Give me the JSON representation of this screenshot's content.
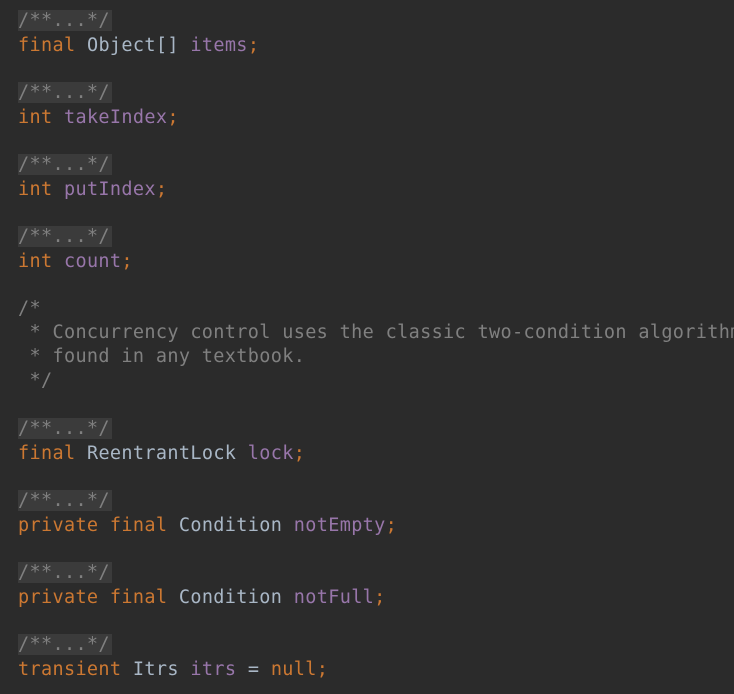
{
  "fold_placeholder": "/**...*/",
  "declarations": [
    {
      "modifiers": "final",
      "type": "Object[]",
      "name": "items",
      "end": ";"
    },
    {
      "modifiers": "int",
      "type": "",
      "name": "takeIndex",
      "end": ";"
    },
    {
      "modifiers": "int",
      "type": "",
      "name": "putIndex",
      "end": ";"
    },
    {
      "modifiers": "int",
      "type": "",
      "name": "count",
      "end": ";"
    },
    {
      "modifiers": "final",
      "type": "ReentrantLock",
      "name": "lock",
      "end": ";"
    },
    {
      "modifiers": "private final",
      "type": "Condition",
      "name": "notEmpty",
      "end": ";"
    },
    {
      "modifiers": "private final",
      "type": "Condition",
      "name": "notFull",
      "end": ";"
    },
    {
      "modifiers": "transient",
      "type": "Itrs",
      "name": "itrs",
      "assign": "=",
      "value": "null",
      "end": ";"
    }
  ],
  "block_comment": [
    "/*",
    " * Concurrency control uses the classic two-condition algorithm",
    " * found in any textbook.",
    " */"
  ],
  "colors": {
    "background": "#2b2b2b",
    "keyword": "#cc7832",
    "field": "#9876aa",
    "type": "#a9b7c6",
    "comment": "#808080",
    "fold_background": "#3b3b3b"
  }
}
